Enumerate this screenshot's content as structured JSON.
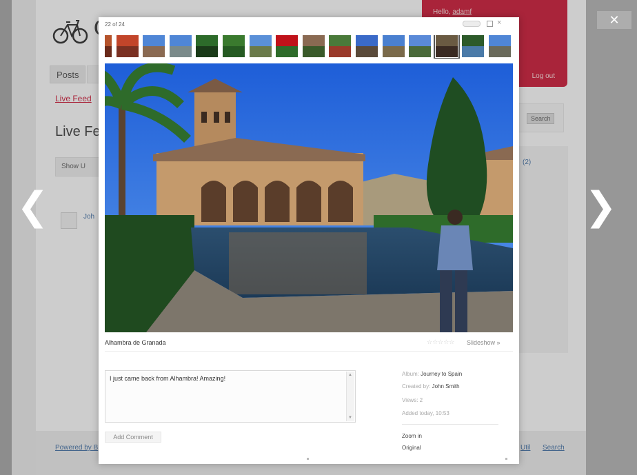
{
  "background": {
    "site_initial": "C",
    "user_greeting_prefix": "Hello, ",
    "user_name": "adamf",
    "logout_label": "Log out",
    "nav_tab_label": "Posts",
    "live_feed_link": "Live Feed",
    "page_heading": "Live Fe",
    "show_button_label": "Show U",
    "author_name": "Joh",
    "search_button_label": "Search",
    "sidebar_link": "(2)",
    "footer_left_link": "Powered by B",
    "footer_mid_link": "Util",
    "footer_search_link": "Search",
    "accent_color": "#c8102e"
  },
  "viewer": {
    "counter": "22 of 24",
    "close_glyph": "✕",
    "prev_glyph": "❮",
    "next_glyph": "❯",
    "thumbnail_count": 16,
    "current_thumbnail_index": 13,
    "caption": "Alhambra de Granada",
    "rating": "☆☆☆☆☆",
    "slideshow_label": "Slideshow »",
    "comment_text": "I just came back from Alhambra! Amazing!",
    "add_comment_label": "Add Comment",
    "meta": {
      "album_label": "Album: ",
      "album_value": "Journey to Spain",
      "created_label": "Created by: ",
      "created_value": "John Smith",
      "views_label": "Views: ",
      "views_value": "2",
      "added": "Added today, 10:53"
    },
    "zoom_in_label": "Zoom in",
    "original_label": "Original"
  }
}
